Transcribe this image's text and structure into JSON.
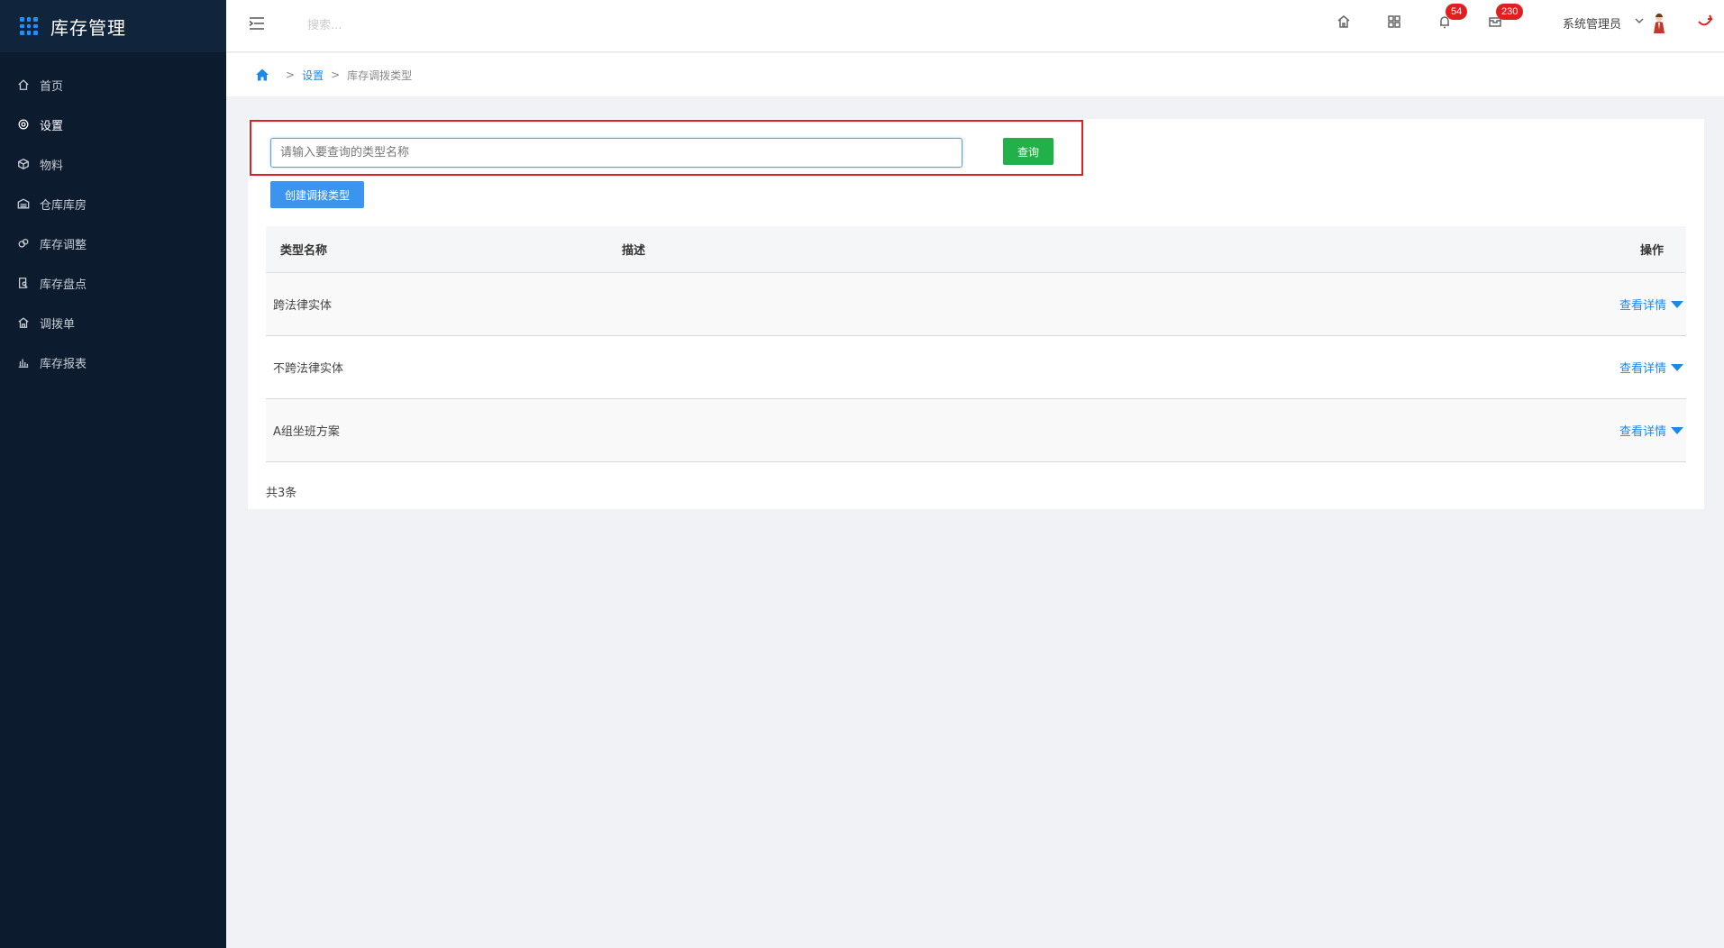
{
  "app": {
    "title": "库存管理"
  },
  "sidebar": {
    "items": [
      {
        "label": "首页",
        "icon": "home-icon"
      },
      {
        "label": "设置",
        "icon": "gear-icon"
      },
      {
        "label": "物料",
        "icon": "cube-icon"
      },
      {
        "label": "仓库库房",
        "icon": "warehouse-icon"
      },
      {
        "label": "库存调整",
        "icon": "adjust-icon"
      },
      {
        "label": "库存盘点",
        "icon": "check-icon"
      },
      {
        "label": "调拨单",
        "icon": "transfer-icon"
      },
      {
        "label": "库存报表",
        "icon": "bar-chart-icon"
      }
    ],
    "active_index": 1
  },
  "header": {
    "search_placeholder": "搜索...",
    "notifications_count": "54",
    "messages_count": "230",
    "user_name": "系统管理员"
  },
  "breadcrumb": {
    "items": [
      "设置",
      "库存调拨类型"
    ]
  },
  "filter": {
    "query_placeholder": "请输入要查询的类型名称",
    "query_button": "查询",
    "create_button": "创建调拨类型"
  },
  "table": {
    "columns": [
      "类型名称",
      "描述",
      "操作"
    ],
    "rows": [
      {
        "name": "跨法律实体",
        "desc": "",
        "action": "查看详情"
      },
      {
        "name": "不跨法律实体",
        "desc": "",
        "action": "查看详情"
      },
      {
        "name": "A组坐班方案",
        "desc": "",
        "action": "查看详情"
      }
    ],
    "total": "共3条"
  },
  "colors": {
    "sidebar_bg": "#0d1b2e",
    "accent": "#1e88e5",
    "query_button": "#22b04a",
    "create_button": "#3b95ee",
    "highlight": "#e02020"
  }
}
